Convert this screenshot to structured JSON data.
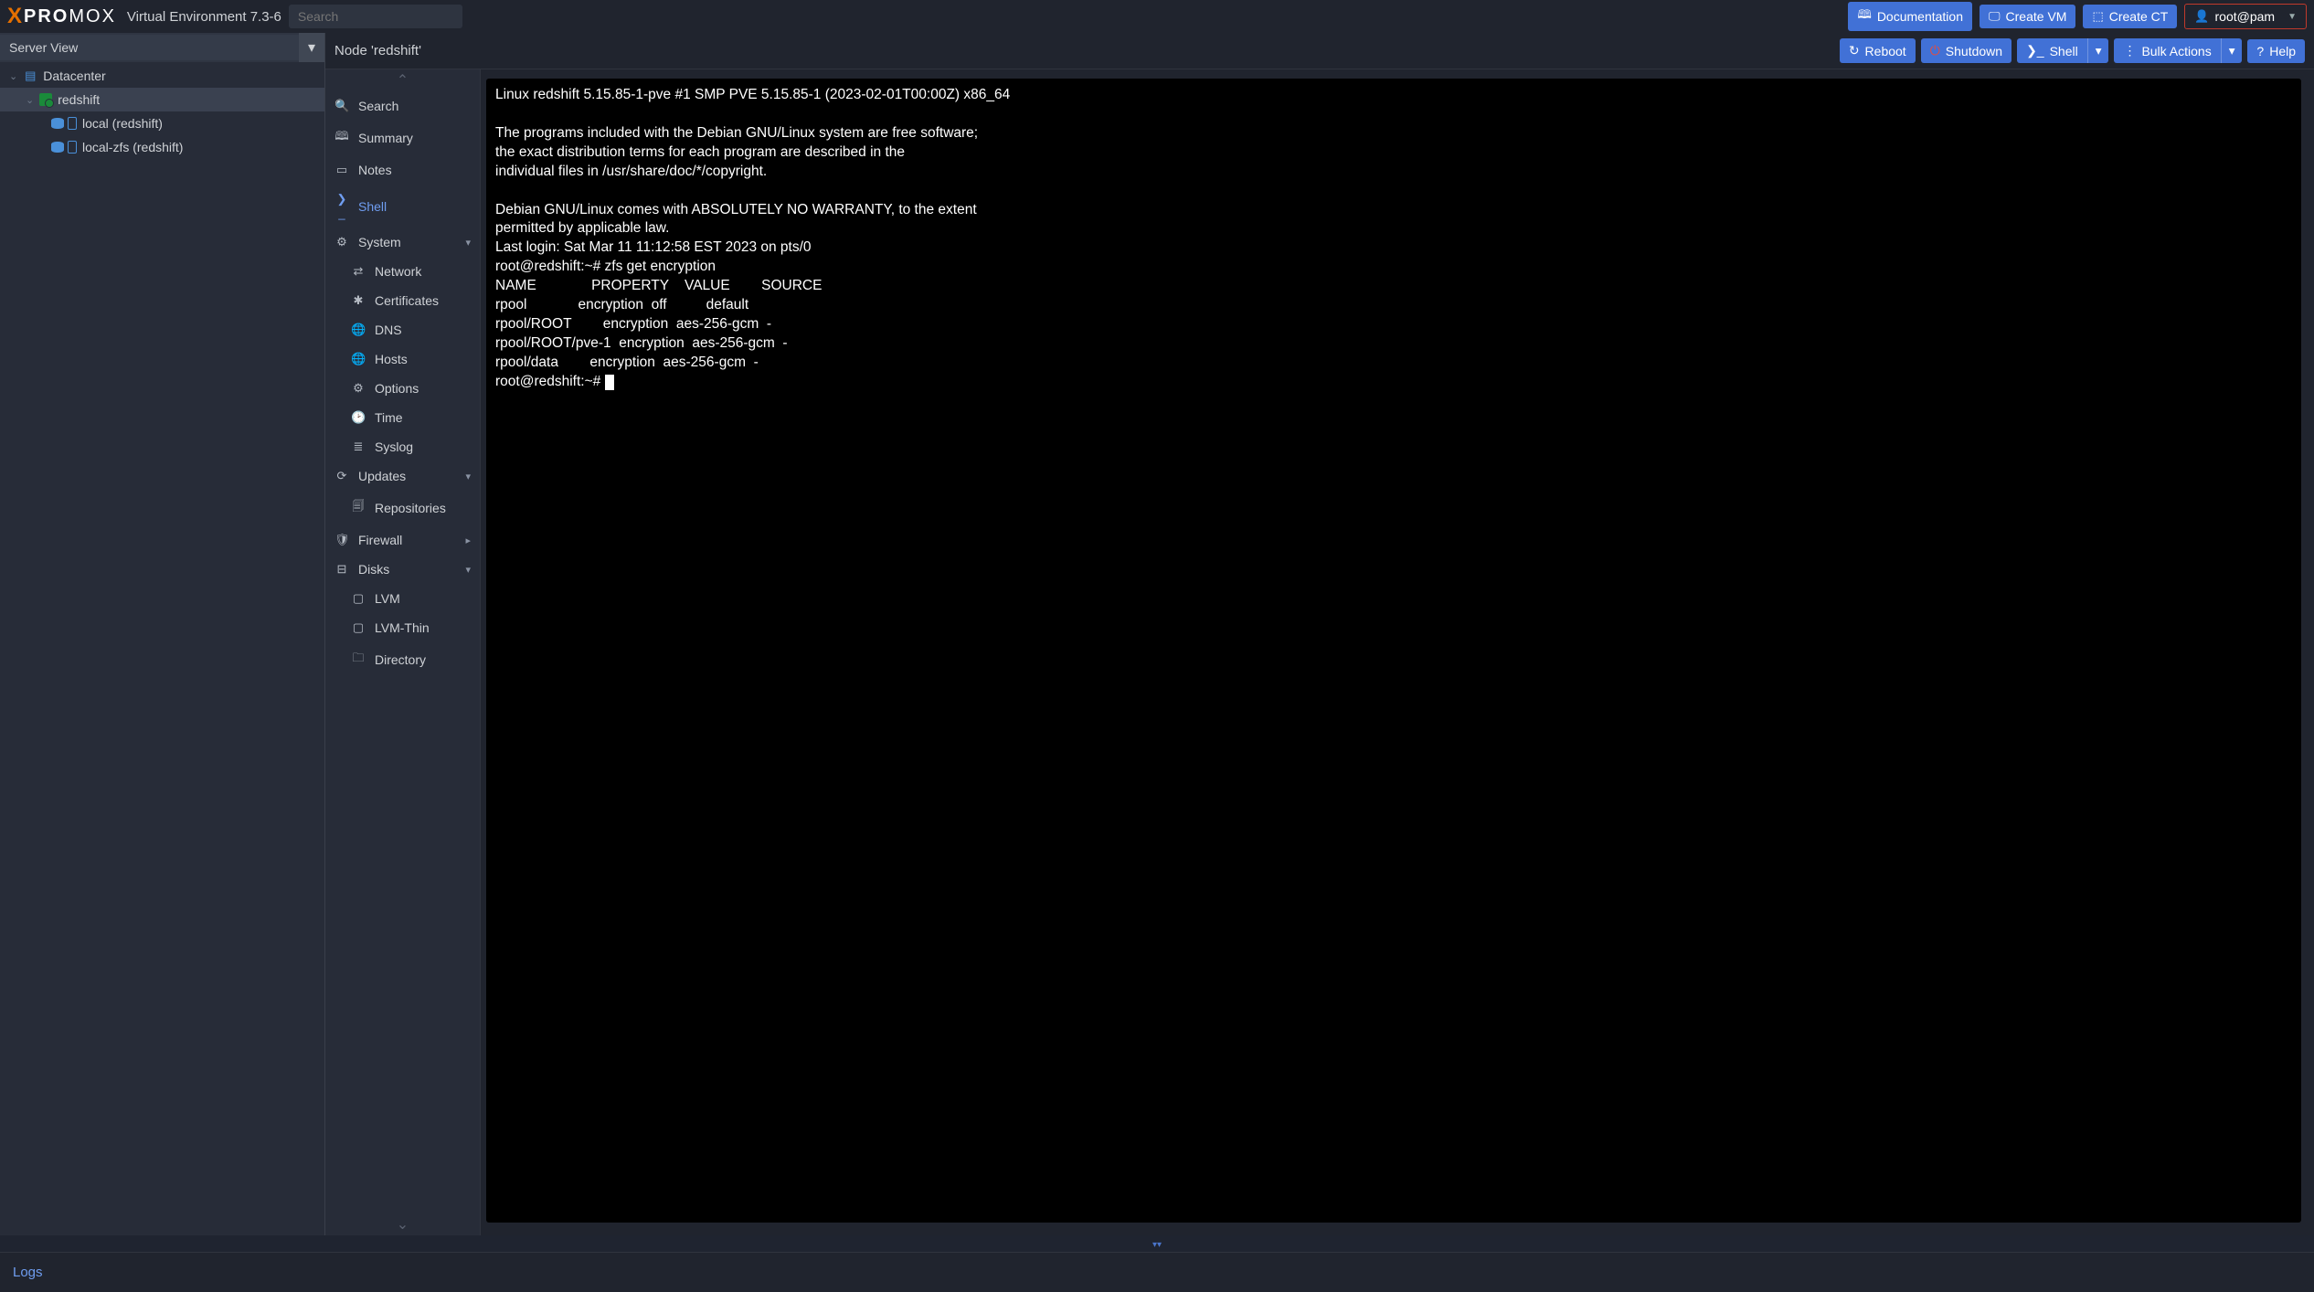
{
  "header": {
    "brand_left": "PRO",
    "brand_right": "MOX",
    "env_label": "Virtual Environment 7.3-6",
    "search_placeholder": "Search",
    "buttons": {
      "documentation": "Documentation",
      "create_vm": "Create VM",
      "create_ct": "Create CT",
      "user": "root@pam"
    }
  },
  "tree": {
    "view_label": "Server View",
    "items": [
      {
        "label": "Datacenter"
      },
      {
        "label": "redshift"
      },
      {
        "label": "local (redshift)"
      },
      {
        "label": "local-zfs (redshift)"
      }
    ]
  },
  "subheader": {
    "title": "Node 'redshift'",
    "buttons": {
      "reboot": "Reboot",
      "shutdown": "Shutdown",
      "shell": "Shell",
      "bulk": "Bulk Actions",
      "help": "Help"
    }
  },
  "sidemenu": {
    "items": [
      {
        "key": "search",
        "label": "Search"
      },
      {
        "key": "summary",
        "label": "Summary"
      },
      {
        "key": "notes",
        "label": "Notes"
      },
      {
        "key": "shell",
        "label": "Shell"
      },
      {
        "key": "system",
        "label": "System"
      },
      {
        "key": "network",
        "label": "Network"
      },
      {
        "key": "certificates",
        "label": "Certificates"
      },
      {
        "key": "dns",
        "label": "DNS"
      },
      {
        "key": "hosts",
        "label": "Hosts"
      },
      {
        "key": "options",
        "label": "Options"
      },
      {
        "key": "time",
        "label": "Time"
      },
      {
        "key": "syslog",
        "label": "Syslog"
      },
      {
        "key": "updates",
        "label": "Updates"
      },
      {
        "key": "repositories",
        "label": "Repositories"
      },
      {
        "key": "firewall",
        "label": "Firewall"
      },
      {
        "key": "disks",
        "label": "Disks"
      },
      {
        "key": "lvm",
        "label": "LVM"
      },
      {
        "key": "lvmthin",
        "label": "LVM-Thin"
      },
      {
        "key": "directory",
        "label": "Directory"
      }
    ]
  },
  "terminal": {
    "line1": "Linux redshift 5.15.85-1-pve #1 SMP PVE 5.15.85-1 (2023-02-01T00:00Z) x86_64",
    "line2": "",
    "line3": "The programs included with the Debian GNU/Linux system are free software;",
    "line4": "the exact distribution terms for each program are described in the",
    "line5": "individual files in /usr/share/doc/*/copyright.",
    "line6": "",
    "line7": "Debian GNU/Linux comes with ABSOLUTELY NO WARRANTY, to the extent",
    "line8": "permitted by applicable law.",
    "line9": "Last login: Sat Mar 11 11:12:58 EST 2023 on pts/0",
    "line10": "root@redshift:~# zfs get encryption",
    "line11": "NAME              PROPERTY    VALUE        SOURCE",
    "line12": "rpool             encryption  off          default",
    "line13": "rpool/ROOT        encryption  aes-256-gcm  -",
    "line14": "rpool/ROOT/pve-1  encryption  aes-256-gcm  -",
    "line15": "rpool/data        encryption  aes-256-gcm  -",
    "line16": "root@redshift:~# "
  },
  "footer": {
    "logs": "Logs"
  }
}
